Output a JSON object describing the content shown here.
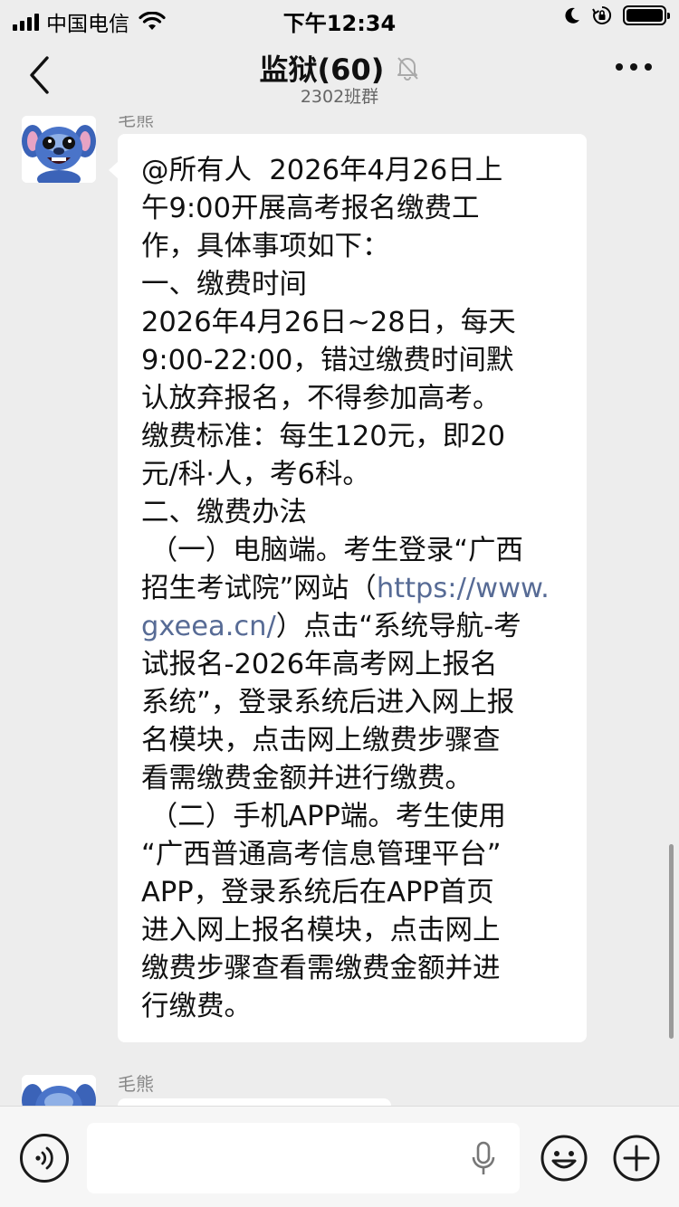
{
  "status_bar": {
    "carrier": "中国电信",
    "time": "下午12:34"
  },
  "nav": {
    "title": "监狱(60)",
    "subtitle": "2302班群"
  },
  "messages": [
    {
      "sender": "毛熊",
      "lines": [
        "@所有人  2026年4月26日上",
        "午9:00开展高考报名缴费工",
        "作，具体事项如下：",
        "一、缴费时间",
        "2026年4月26日~28日，每天",
        "9:00-22:00，错过缴费时间默",
        "认放弃报名，不得参加高考。",
        "缴费标准：每生120元，即20",
        "元/科·人，考6科。",
        "二、缴费办法",
        " （一）电脑端。考生登录“广西",
        "招生考试院”网站（",
        "https://www.",
        "gxeea.cn/",
        "）点击“系统导航-考",
        "试报名-2026年高考网上报名",
        "系统”，登录系统后进入网上报",
        "名模块，点击网上缴费步骤查",
        "看需缴费金额并进行缴费。",
        " （二）手机APP端。考生使用",
        "“广西普通高考信息管理平台”",
        "APP，登录系统后在APP首页",
        "进入网上报名模块，点击网上",
        "缴费步骤查看需缴费金额并进",
        "行缴费。"
      ]
    },
    {
      "sender": "毛熊"
    }
  ],
  "colors": {
    "background": "#ededed",
    "bubble": "#ffffff",
    "link": "#576b95"
  },
  "icons": [
    "back-icon",
    "mute-icon",
    "more-icon",
    "voice-icon",
    "mic-icon",
    "emoji-icon",
    "plus-icon"
  ]
}
